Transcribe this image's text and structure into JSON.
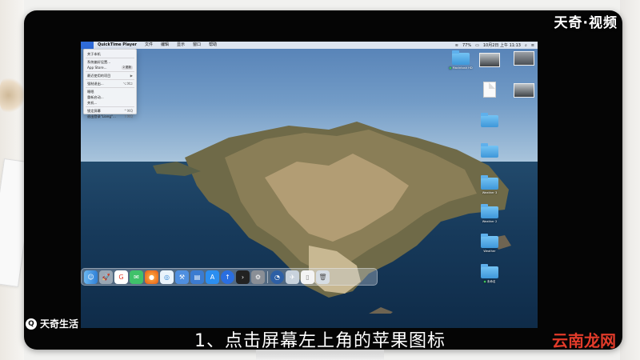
{
  "watermark": "天奇·视频",
  "brand": {
    "icon": "search-icon",
    "label": "天奇生活"
  },
  "subtitle": "1、点击屏幕左上角的苹果图标",
  "site_mark": "云南龙网",
  "menubar": {
    "apple_icon": "apple-icon",
    "items": [
      "QuickTime Player",
      "文件",
      "编辑",
      "显示",
      "窗口",
      "帮助"
    ],
    "status": {
      "battery": "77%",
      "clock": "10月2日 上午 11:13"
    }
  },
  "apple_menu": {
    "items": [
      {
        "label": "关于本机"
      },
      {
        "label": "系统偏好设置..."
      },
      {
        "label": "App Store...",
        "badge": "2 更新"
      },
      {
        "label": "最近使用的项目",
        "shortcut": "▶"
      },
      {
        "label": "强制退出...",
        "shortcut": "⌥⌘⎋"
      },
      {
        "label": "睡眠"
      },
      {
        "label": "重新启动..."
      },
      {
        "label": "关机..."
      },
      {
        "label": "锁定屏幕",
        "shortcut": "^⌘Q"
      },
      {
        "label": "退出登录\"Liang\"...",
        "shortcut": "⇧⌘Q"
      }
    ]
  },
  "desktop": {
    "labels": [
      "Macintosh HD",
      "Weather 3",
      "Weather 2",
      "Weather",
      "未命名"
    ]
  },
  "dock": {
    "items": [
      "finder-icon",
      "launchpad-icon",
      "app-icon",
      "wechat-icon",
      "firefox-icon",
      "safari-icon",
      "xcode-icon",
      "files-icon",
      "appstore-icon",
      "upload-icon",
      "terminal-icon",
      "settings-icon",
      "quicktime-icon",
      "preview-icon",
      "document-icon",
      "trash-icon"
    ]
  }
}
